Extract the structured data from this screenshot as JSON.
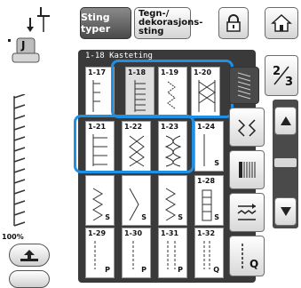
{
  "top_bar": {
    "stitch_types_label": "Sting typer",
    "decorative_label_line1": "Tegn-/",
    "decorative_label_line2": "dekorasjons-",
    "decorative_label_line3": "sting"
  },
  "left_panel": {
    "presser_foot_letter": "J",
    "zoom_level": "100%"
  },
  "grid": {
    "header": "1-18  Kasteting",
    "cells": [
      {
        "num": "1-17",
        "suffix": ""
      },
      {
        "num": "1-18",
        "suffix": ""
      },
      {
        "num": "1-19",
        "suffix": ""
      },
      {
        "num": "1-20",
        "suffix": ""
      },
      {
        "num": "1-21",
        "suffix": ""
      },
      {
        "num": "1-22",
        "suffix": ""
      },
      {
        "num": "1-23",
        "suffix": ""
      },
      {
        "num": "1-24",
        "suffix": "S"
      },
      {
        "num": "",
        "suffix": "S"
      },
      {
        "num": "",
        "suffix": "S"
      },
      {
        "num": "",
        "suffix": "S"
      },
      {
        "num": "1-28",
        "suffix": "S"
      },
      {
        "num": "1-29",
        "suffix": "P"
      },
      {
        "num": "1-30",
        "suffix": "P"
      },
      {
        "num": "1-31",
        "suffix": "P"
      },
      {
        "num": "1-32",
        "suffix": "Q"
      }
    ]
  },
  "right_panel": {
    "page_current": "2",
    "page_total": "3",
    "q_label": "Q"
  },
  "colors": {
    "highlight": "#1e90e6",
    "panel_dark": "#3a3a3a"
  }
}
